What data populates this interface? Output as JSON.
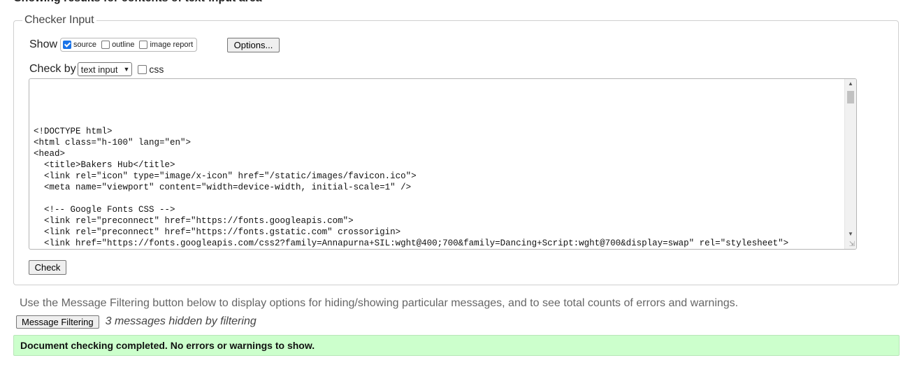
{
  "page": {
    "heading": "Showing results for contents of text-input area"
  },
  "checker": {
    "legend": "Checker Input",
    "show_label": "Show",
    "show_options": [
      {
        "label": "source",
        "checked": true
      },
      {
        "label": "outline",
        "checked": false
      },
      {
        "label": "image report",
        "checked": false
      }
    ],
    "options_button": "Options...",
    "check_by_label": "Check by",
    "check_by_select": "text input",
    "css_label": "css",
    "css_checked": false,
    "source_text": "<!DOCTYPE html>\n<html class=\"h-100\" lang=\"en\">\n<head>\n  <title>Bakers Hub</title>\n  <link rel=\"icon\" type=\"image/x-icon\" href=\"/static/images/favicon.ico\">\n  <meta name=\"viewport\" content=\"width=device-width, initial-scale=1\" />\n\n  <!-- Google Fonts CSS -->\n  <link rel=\"preconnect\" href=\"https://fonts.googleapis.com\">\n  <link rel=\"preconnect\" href=\"https://fonts.gstatic.com\" crossorigin>\n  <link href=\"https://fonts.googleapis.com/css2?family=Annapurna+SIL:wght@400;700&family=Dancing+Script:wght@700&display=swap\" rel=\"stylesheet\">",
    "check_button": "Check"
  },
  "filtering": {
    "info_text": "Use the Message Filtering button below to display options for hiding/showing particular messages, and to see total counts of errors and warnings.",
    "button": "Message Filtering",
    "hidden_count": "3 messages hidden by filtering"
  },
  "result": {
    "message": "Document checking completed. No errors or warnings to show."
  },
  "colors": {
    "success_bg": "#ccffcc",
    "checkbox_accent": "#1a73e8"
  }
}
